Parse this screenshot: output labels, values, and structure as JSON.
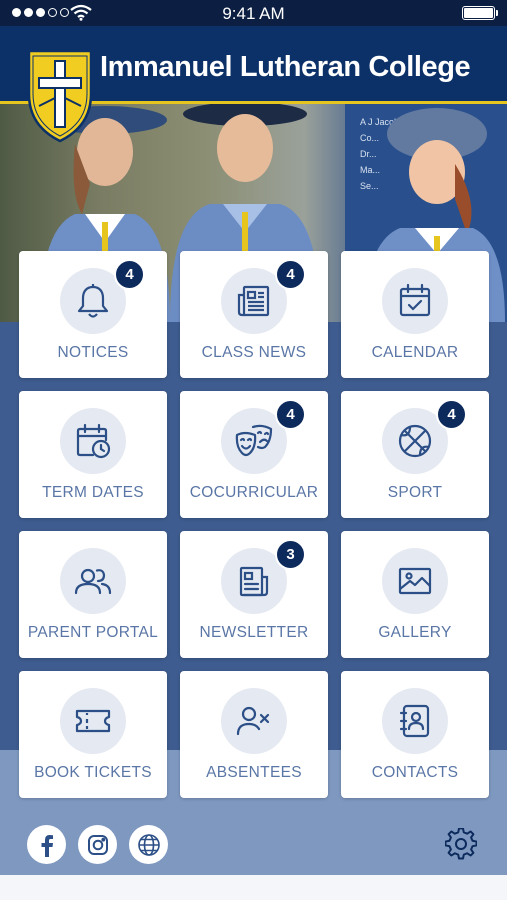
{
  "status_bar": {
    "time": "9:41 AM"
  },
  "header": {
    "title": "Immanuel Lutheran College"
  },
  "hero": {
    "sign_lines": [
      "A J Jacob Studio",
      "Co...",
      "Dr...",
      "Ma...",
      "Se..."
    ]
  },
  "tiles": [
    {
      "label": "NOTICES",
      "icon": "bell-icon",
      "badge": "4"
    },
    {
      "label": "CLASS NEWS",
      "icon": "newspaper-icon",
      "badge": "4"
    },
    {
      "label": "CALENDAR",
      "icon": "calendar-check-icon",
      "badge": ""
    },
    {
      "label": "TERM DATES",
      "icon": "calendar-clock-icon",
      "badge": ""
    },
    {
      "label": "COCURRICULAR",
      "icon": "theatre-masks-icon",
      "badge": "4"
    },
    {
      "label": "SPORT",
      "icon": "basketball-icon",
      "badge": "4"
    },
    {
      "label": "PARENT PORTAL",
      "icon": "users-icon",
      "badge": ""
    },
    {
      "label": "NEWSLETTER",
      "icon": "newsletter-icon",
      "badge": "3"
    },
    {
      "label": "GALLERY",
      "icon": "image-icon",
      "badge": ""
    },
    {
      "label": "BOOK TICKETS",
      "icon": "ticket-icon",
      "badge": ""
    },
    {
      "label": "ABSENTEES",
      "icon": "user-x-icon",
      "badge": ""
    },
    {
      "label": "CONTACTS",
      "icon": "contact-book-icon",
      "badge": ""
    }
  ],
  "footer": {
    "social": [
      "facebook-icon",
      "instagram-icon",
      "globe-icon"
    ],
    "settings": "gear-icon"
  },
  "colors": {
    "navy": "#0c3168",
    "gold": "#e6c51e",
    "panel": "#3e5c8f",
    "panel_light": "#7e98c0",
    "label": "#5a76a6",
    "icon": "#2b4f86",
    "badge": "#0c2a5c"
  }
}
